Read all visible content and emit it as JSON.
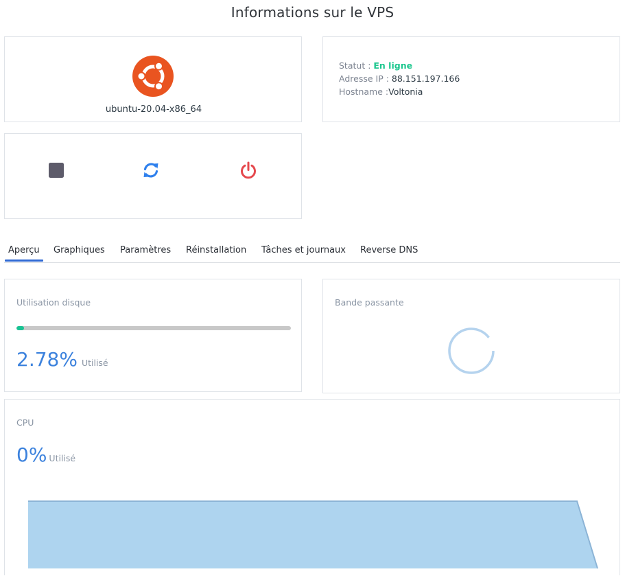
{
  "page": {
    "title": "Informations sur le VPS"
  },
  "os": {
    "name": "ubuntu-20.04-x86_64",
    "logo_icon": "ubuntu-logo-icon",
    "logo_color": "#e95420"
  },
  "info": {
    "status_label": "Statut : ",
    "status_value": "En ligne",
    "status_color": "#1ec78f",
    "ip_label": "Adresse IP : ",
    "ip_value": "88.151.197.166",
    "hostname_label": "Hostname :",
    "hostname_value": "Voltonia"
  },
  "actions": [
    {
      "name": "stop-button",
      "icon": "stop-icon",
      "color": "#5d5b6a"
    },
    {
      "name": "restart-button",
      "icon": "refresh-icon",
      "color": "#2f80ed"
    },
    {
      "name": "power-button",
      "icon": "power-icon",
      "color": "#e5484d"
    }
  ],
  "tabs": [
    {
      "label": "Aperçu",
      "active": true
    },
    {
      "label": "Graphiques",
      "active": false
    },
    {
      "label": "Paramètres",
      "active": false
    },
    {
      "label": "Réinstallation",
      "active": false
    },
    {
      "label": "Tâches et journaux",
      "active": false
    },
    {
      "label": "Reverse DNS",
      "active": false
    }
  ],
  "disk": {
    "label": "Utilisation disque",
    "percent_text": "2.78%",
    "unit": "Utilisé",
    "usage_fraction": 0.0278,
    "bar_color": "#18c393"
  },
  "bandwidth": {
    "label": "Bande passante",
    "loading": true
  },
  "cpu": {
    "label": "CPU",
    "percent_text": "0%",
    "unit": "Utilisé",
    "fill_color": "#aed4ef",
    "line_color": "#8cb4d6"
  }
}
